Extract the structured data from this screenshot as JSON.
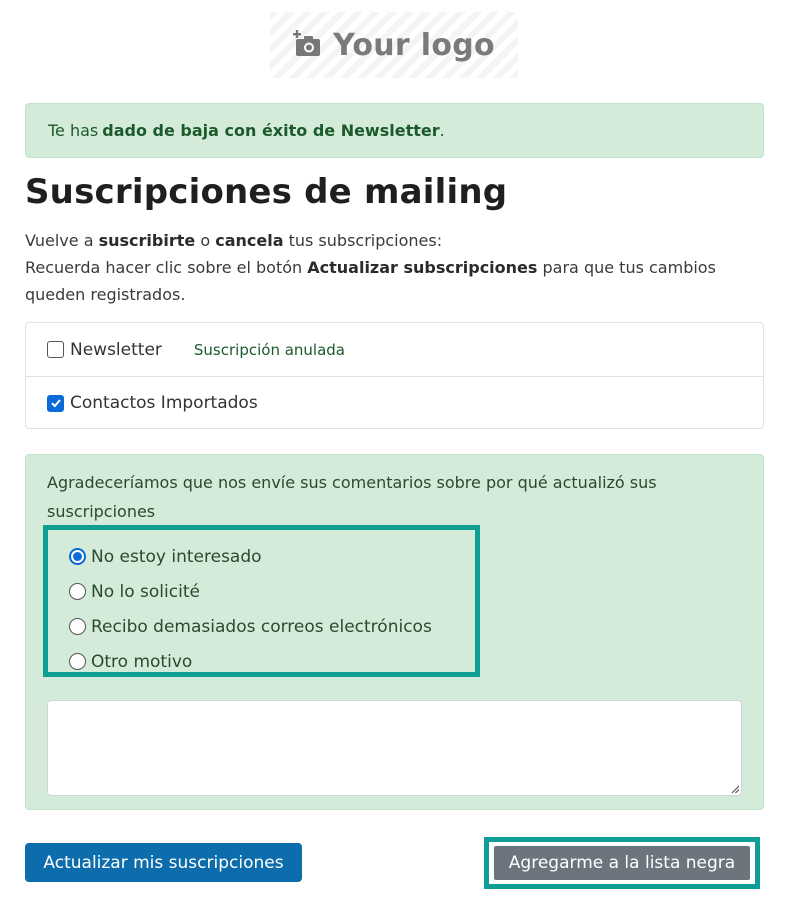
{
  "logo": {
    "text": "Your logo",
    "icon": "camera-plus-icon"
  },
  "alert": {
    "prefix": "Te has",
    "bold": "dado de baja con éxito de Newsletter",
    "suffix": "."
  },
  "title": "Suscripciones de mailing",
  "intro": {
    "line1_a": "Vuelve a",
    "line1_b": "suscribirte",
    "line1_c": "o",
    "line1_d": "cancela",
    "line1_e": "tus subscripciones:",
    "line2_a": "Recuerda hacer clic sobre el botón",
    "line2_b": "Actualizar subscripciones",
    "line2_c": "para que tus cambios queden registrados."
  },
  "lists": [
    {
      "label": "Newsletter",
      "checked": false,
      "status": "Suscripción anulada"
    },
    {
      "label": "Contactos Importados",
      "checked": true,
      "status": ""
    }
  ],
  "feedback": {
    "prompt": "Agradeceríamos que nos envíe sus comentarios sobre por qué actualizó sus suscripciones",
    "reasons": [
      {
        "label": "No estoy interesado",
        "selected": true
      },
      {
        "label": "No lo solicité",
        "selected": false
      },
      {
        "label": "Recibo demasiados correos electrónicos",
        "selected": false
      },
      {
        "label": "Otro motivo",
        "selected": false
      }
    ],
    "comment_value": ""
  },
  "buttons": {
    "update": "Actualizar mis suscripciones",
    "blacklist": "Agregarme a la lista negra"
  },
  "colors": {
    "success_bg": "#d4ebd9",
    "primary": "#0d6cab",
    "secondary": "#6c757d",
    "highlight": "#0e9e94",
    "checkbox": "#0b69d8"
  }
}
